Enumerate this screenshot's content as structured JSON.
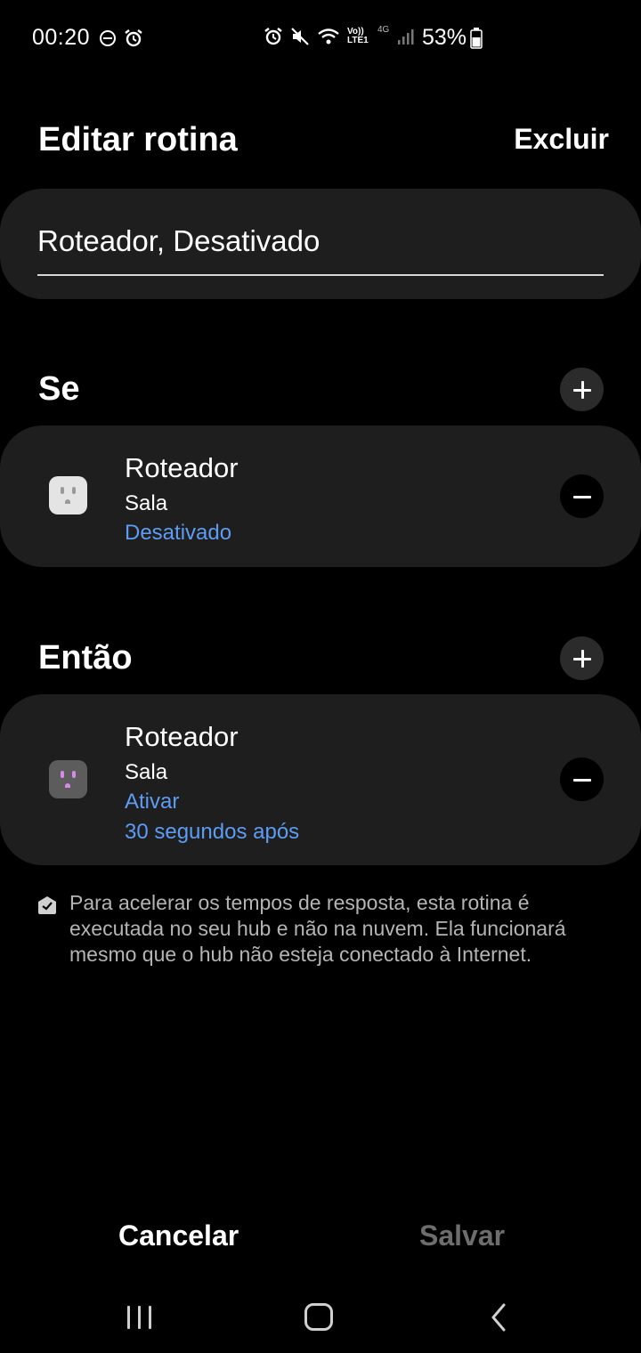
{
  "status_bar": {
    "time": "00:20",
    "battery": "53%",
    "network_small": "Vo)) LTE1",
    "network_type": "4G",
    "icons": [
      "do-not-disturb-icon",
      "alarm-icon",
      "alarm-icon",
      "mute-icon",
      "wifi-icon",
      "signal-icon",
      "battery-icon"
    ]
  },
  "header": {
    "title": "Editar rotina",
    "delete_label": "Excluir"
  },
  "routine_name": {
    "value": "Roteador, Desativado"
  },
  "if_section": {
    "title": "Se",
    "device": {
      "name": "Roteador",
      "room": "Sala",
      "state": "Desativado",
      "icon": "power-outlet-off-icon"
    }
  },
  "then_section": {
    "title": "Então",
    "device": {
      "name": "Roteador",
      "room": "Sala",
      "action": "Ativar",
      "delay": "30 segundos após",
      "icon": "power-outlet-on-icon"
    }
  },
  "info_note": {
    "text": "Para acelerar os tempos de resposta, esta rotina é executada no seu hub e não na nuvem. Ela funcionará mesmo que o hub não esteja conectado à Internet.",
    "icon": "hub-icon"
  },
  "actions": {
    "cancel_label": "Cancelar",
    "save_label": "Salvar"
  },
  "colors": {
    "background": "#000000",
    "card": "#1e1e1e",
    "accent": "#5d9cf5",
    "disabled_text": "#6d6d6d",
    "outlet_on": "#d58be6"
  }
}
